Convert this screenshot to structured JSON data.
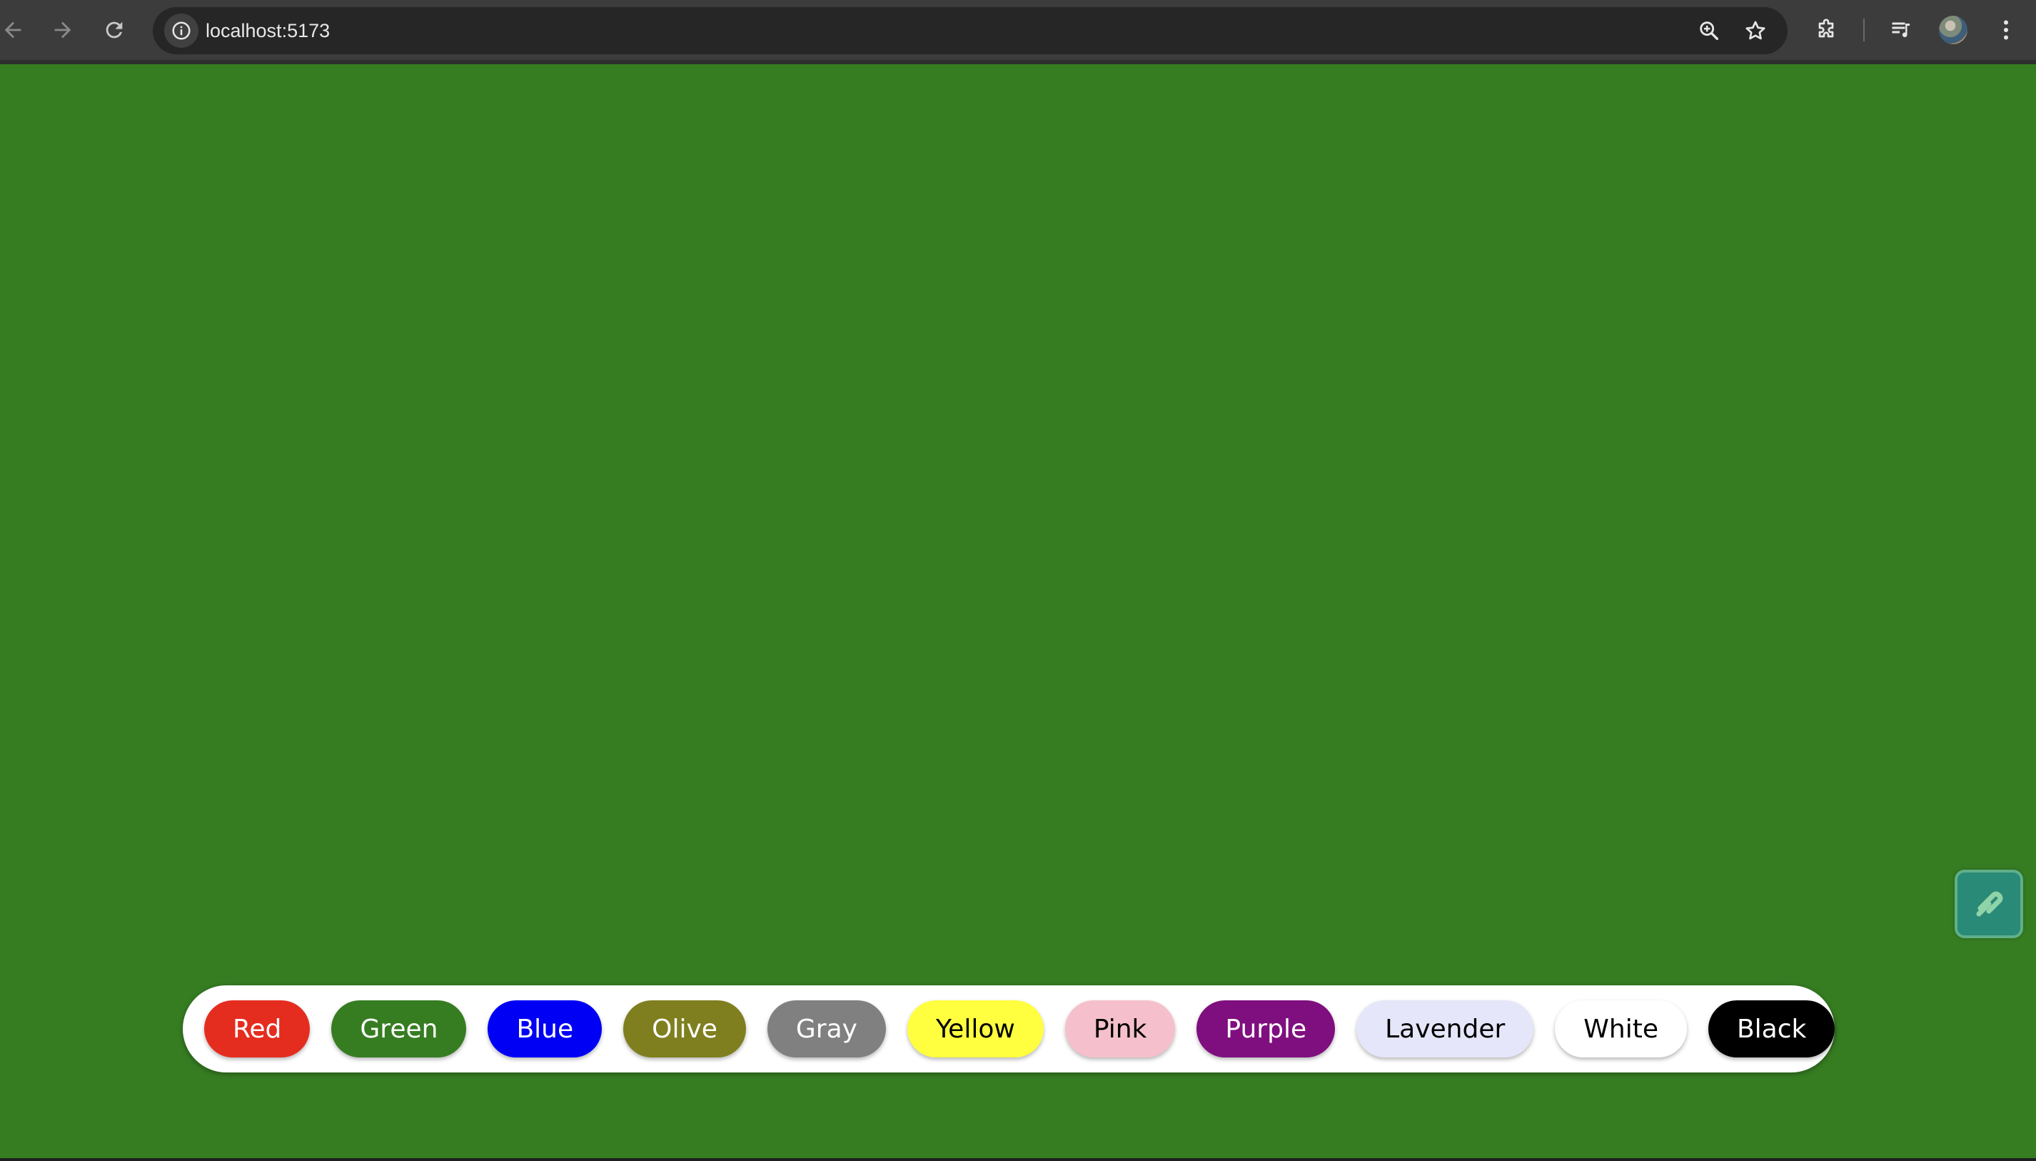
{
  "browser": {
    "url": "localhost:5173",
    "nav": {
      "back_icon": "arrow-left-icon",
      "forward_icon": "arrow-right-icon",
      "reload_icon": "reload-icon"
    },
    "omnibox_icons": [
      "info-icon",
      "zoom-icon",
      "star-icon"
    ],
    "toolbar_icons": [
      "extensions-icon",
      "media-controls-icon",
      "profile-avatar",
      "more-vert-icon"
    ]
  },
  "page": {
    "background_color": "#367d22"
  },
  "color_bar": {
    "buttons": [
      {
        "label": "Red",
        "bg": "#e52d1f",
        "fg": "#ffffff"
      },
      {
        "label": "Green",
        "bg": "#367d22",
        "fg": "#ffffff"
      },
      {
        "label": "Blue",
        "bg": "#0000f5",
        "fg": "#ffffff"
      },
      {
        "label": "Olive",
        "bg": "#7f7f1f",
        "fg": "#ffffff"
      },
      {
        "label": "Gray",
        "bg": "#808080",
        "fg": "#ffffff"
      },
      {
        "label": "Yellow",
        "bg": "#ffff40",
        "fg": "#000000"
      },
      {
        "label": "Pink",
        "bg": "#f5c0cb",
        "fg": "#000000"
      },
      {
        "label": "Purple",
        "bg": "#7f0f7f",
        "fg": "#ffffff"
      },
      {
        "label": "Lavender",
        "bg": "#e6e6fa",
        "fg": "#000000"
      },
      {
        "label": "White",
        "bg": "#ffffff",
        "fg": "#000000"
      },
      {
        "label": "Black",
        "bg": "#000000",
        "fg": "#ffffff"
      }
    ]
  },
  "floating_widget": {
    "icon": "sider-extension-icon",
    "accent": "#2a8a78"
  }
}
